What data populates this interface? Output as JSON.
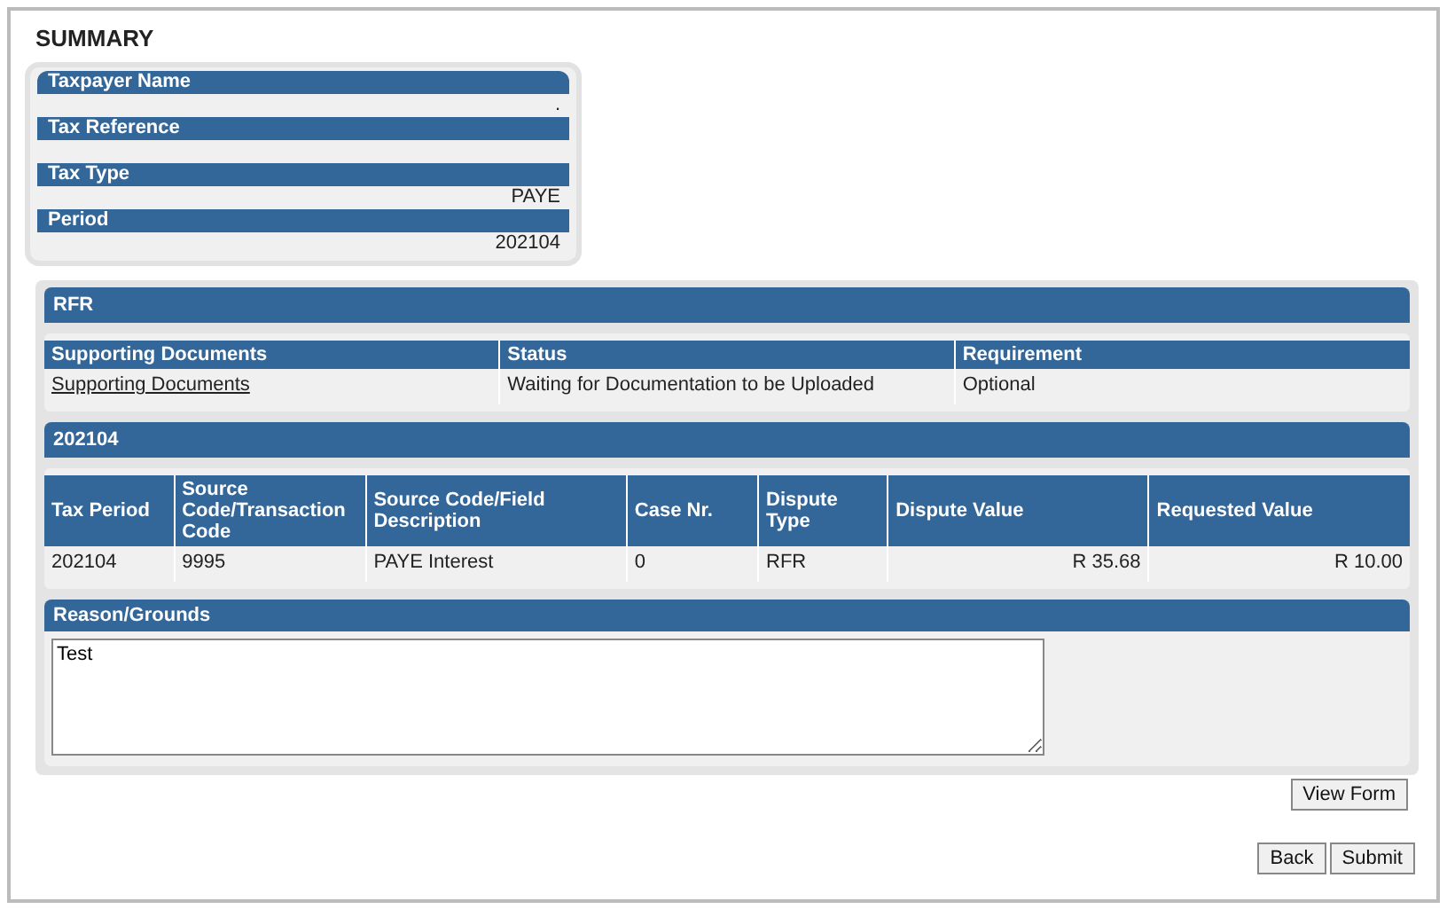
{
  "title": "SUMMARY",
  "summary": [
    {
      "label": "Taxpayer Name",
      "value": "."
    },
    {
      "label": "Tax Reference"
    },
    {
      "label": "Tax Type",
      "value": "PAYE"
    },
    {
      "label": "Period",
      "value": "202104"
    }
  ],
  "rfr_section": {
    "heading": "RFR",
    "documents_table": {
      "columns": [
        "Supporting Documents",
        "Status",
        "Requirement"
      ],
      "rows": [
        {
          "document_link": "Supporting Documents",
          "status": "Waiting for Documentation to be Uploaded",
          "requirement": "Optional"
        }
      ]
    }
  },
  "period_section": {
    "heading": "202104",
    "table": {
      "columns": [
        "Tax Period",
        "Source Code/Transaction Code",
        "Source Code/Field Description",
        "Case Nr.",
        "Dispute Type",
        "Dispute Value",
        "Requested Value"
      ],
      "rows": [
        [
          "202104",
          "9995",
          "PAYE Interest",
          "0",
          "RFR",
          "R 35.68",
          "R 10.00"
        ]
      ]
    }
  },
  "reason": {
    "heading": "Reason/Grounds",
    "value": "Test"
  },
  "buttons": {
    "view_form": "View Form",
    "back": "Back",
    "submit": "Submit"
  }
}
